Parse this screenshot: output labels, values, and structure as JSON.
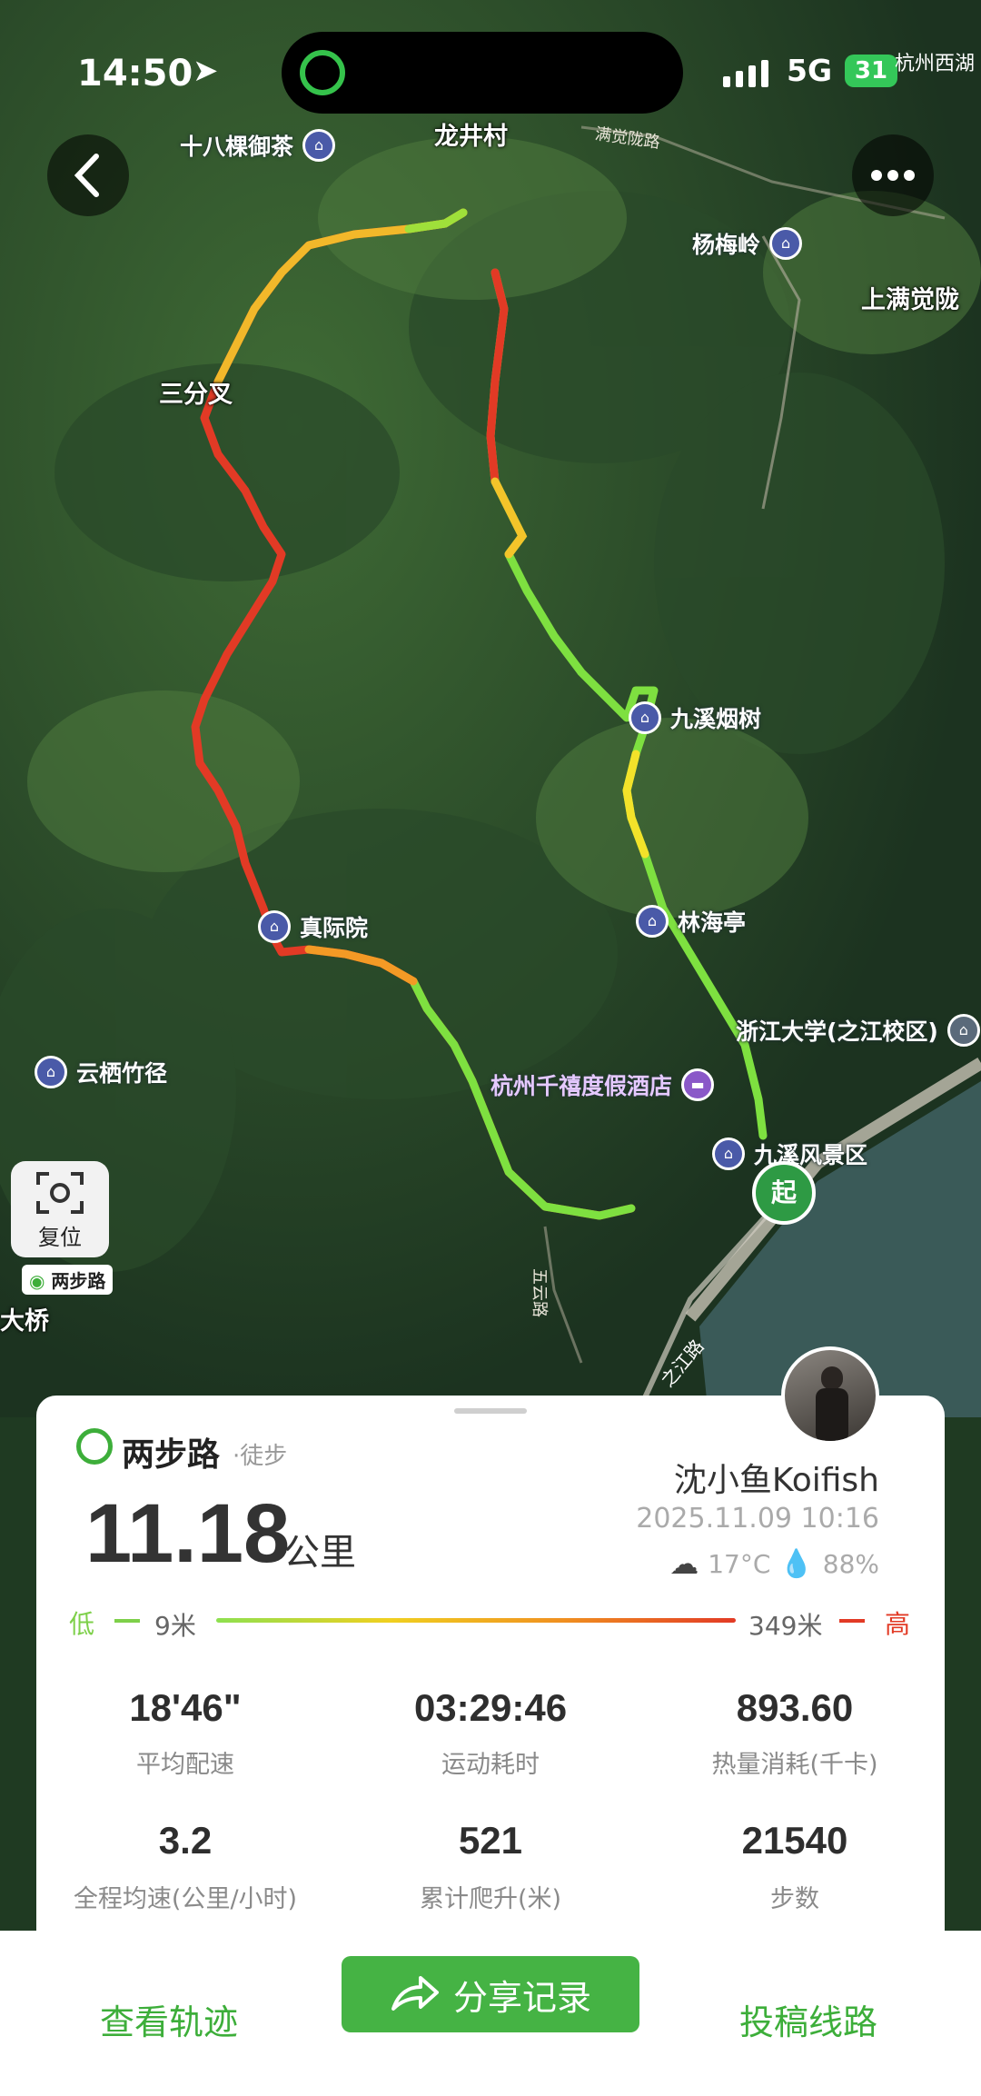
{
  "status_bar": {
    "time": "14:50",
    "network": "5G",
    "battery": "31"
  },
  "map": {
    "places": [
      "龙井村",
      "三分叉",
      "上满觉陇",
      "大桥"
    ],
    "roads": [
      "满觉陇路",
      "五云路",
      "之江路",
      "杭州西湖"
    ],
    "pois": [
      "十八棵御茶",
      "杨梅岭",
      "九溪烟树",
      "林海亭",
      "真际院",
      "云栖竹径",
      "浙江大学(之江校区)",
      "杭州千禧度假酒店",
      "九溪风景区"
    ],
    "start_marker": "起",
    "reset_label": "复位",
    "watermark": "两步路",
    "colors": {
      "low": "#6fe040",
      "mid": "#f0d020",
      "high": "#e23a25"
    }
  },
  "summary": {
    "brand": "两步路",
    "activity": "·徒步",
    "distance": "11.18",
    "distance_unit": "公里",
    "user_name": "沈小鱼Koifish",
    "datetime": "2025.11.09 10:16",
    "temperature": "17°C",
    "humidity": "88%",
    "elevation": {
      "low_label": "低",
      "low_value": "9米",
      "high_value": "349米",
      "high_label": "高"
    },
    "stats": [
      {
        "value": "18'46\"",
        "label": "平均配速"
      },
      {
        "value": "03:29:46",
        "label": "运动耗时"
      },
      {
        "value": "893.60",
        "label": "热量消耗(千卡)"
      },
      {
        "value": "3.2",
        "label": "全程均速(公里/小时)"
      },
      {
        "value": "521",
        "label": "累计爬升(米)"
      },
      {
        "value": "21540",
        "label": "步数"
      }
    ]
  },
  "actions": {
    "view_track": "查看轨迹",
    "share": "分享记录",
    "submit_route": "投稿线路"
  }
}
